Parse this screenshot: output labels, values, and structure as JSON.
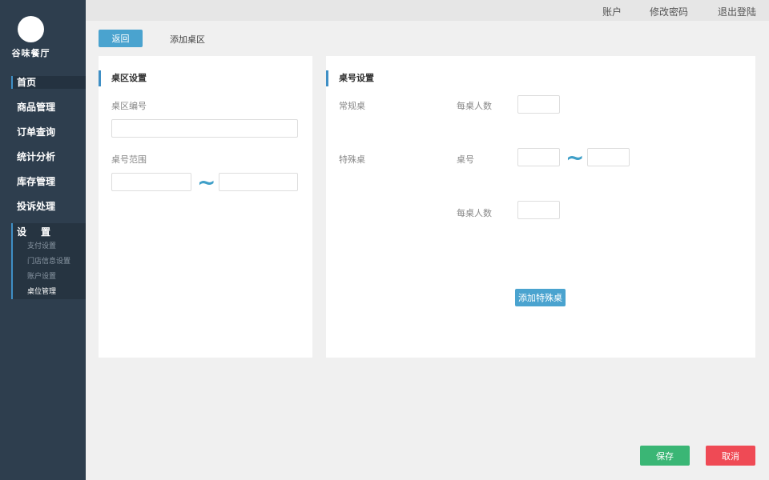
{
  "sidebar": {
    "brand": "谷味餐厅",
    "items": [
      {
        "label": "首页"
      },
      {
        "label": "商品管理"
      },
      {
        "label": "订单查询"
      },
      {
        "label": "统计分析"
      },
      {
        "label": "库存管理"
      },
      {
        "label": "投诉处理"
      }
    ],
    "settings": {
      "title_a": "设",
      "title_b": "置",
      "sub_items": [
        {
          "label": "支付设置"
        },
        {
          "label": "门店信息设置"
        },
        {
          "label": "账户设置"
        },
        {
          "label": "桌位管理"
        }
      ]
    }
  },
  "topbar": {
    "account": "账户",
    "change_password": "修改密码",
    "logout": "退出登陆"
  },
  "toolbar": {
    "back_label": "返回",
    "page_title": "添加桌区"
  },
  "zone_panel": {
    "heading": "桌区设置",
    "zone_number_label": "桌区编号",
    "zone_number_value": "",
    "table_range_label": "桌号范围",
    "range_from": "",
    "range_to": "",
    "separator": "~"
  },
  "table_panel": {
    "heading": "桌号设置",
    "regular_label": "常规桌",
    "regular_seats_label": "每桌人数",
    "regular_seats_value": "",
    "special_label": "特殊桌",
    "table_no_label": "桌号",
    "special_from": "",
    "special_to": "",
    "separator": "~",
    "special_seats_label": "每桌人数",
    "special_seats_value": "",
    "add_special_label": "添加特殊桌"
  },
  "footer": {
    "save_label": "保存",
    "cancel_label": "取消"
  },
  "colors": {
    "sidebar_bg": "#2e3e4e",
    "accent_blue": "#4aa3cf",
    "save_green": "#3ab675",
    "cancel_red": "#ef4a55"
  }
}
